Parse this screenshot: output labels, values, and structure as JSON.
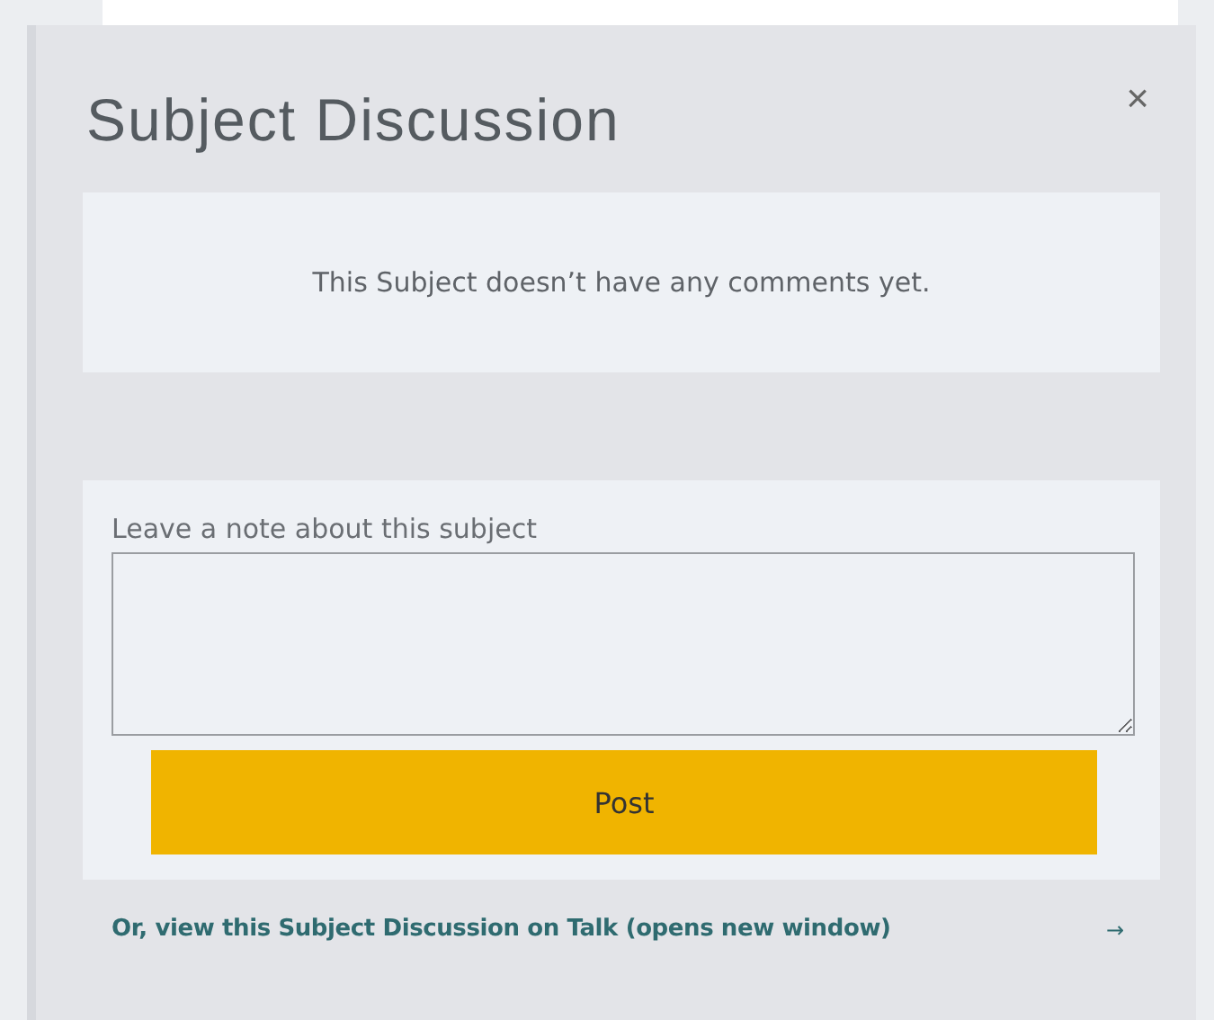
{
  "dialog": {
    "title": "Subject Discussion",
    "close": "×"
  },
  "empty_message": "This Subject doesn’t have any comments yet.",
  "form": {
    "label": "Leave a note about this subject",
    "submit": "Post"
  },
  "talk_link": {
    "text": "Or, view this Subject Discussion on Talk (opens new window)",
    "arrow": "→"
  }
}
